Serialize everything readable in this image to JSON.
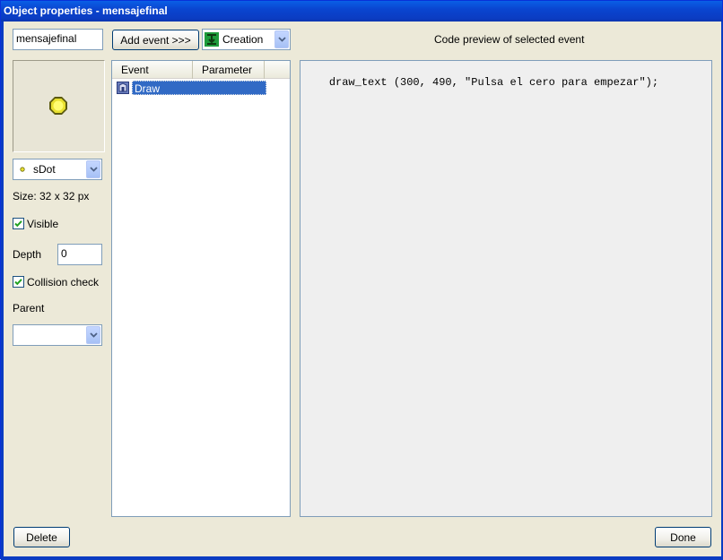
{
  "window": {
    "title": "Object properties - mensajefinal"
  },
  "object": {
    "name_value": "mensajefinal",
    "sprite_selected": "sDot",
    "size_text": "Size: 32 x 32 px",
    "visible_label": "Visible",
    "visible_checked": true,
    "depth_label": "Depth",
    "depth_value": "0",
    "collision_label": "Collision check",
    "collision_checked": true,
    "parent_label": "Parent",
    "parent_value": ""
  },
  "toolbar": {
    "add_event_label": "Add event >>>",
    "event_category_selected": "Creation"
  },
  "events": {
    "columns": [
      "Event",
      "Parameter"
    ],
    "rows": [
      {
        "event": "Draw",
        "parameter": "",
        "selected": true
      }
    ]
  },
  "code_preview": {
    "title": "Code preview of selected event",
    "code": "draw_text (300, 490, \"Pulsa el cero para empezar\");"
  },
  "footer": {
    "delete_label": "Delete",
    "done_label": "Done"
  },
  "colors": {
    "titlebar": "#0a45d0",
    "selection": "#316ac5",
    "window_bg": "#ece9d8"
  },
  "icons": {
    "sprite": "yellow-dot-icon",
    "creation": "creation-event-icon",
    "draw": "draw-event-icon",
    "dropdown": "chevron-down-icon",
    "check": "checkmark-icon"
  }
}
